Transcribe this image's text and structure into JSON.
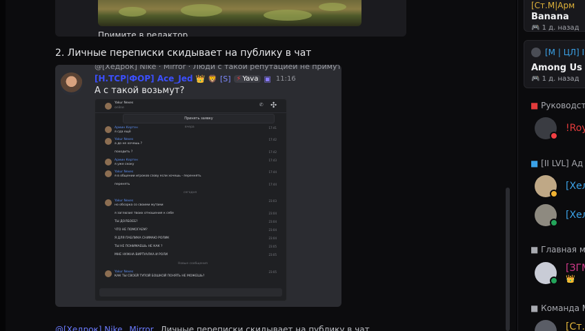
{
  "chat": {
    "top_card_caption": "Примите в редактор",
    "heading": "2. Личные переписки скидывает на публику в чат",
    "embed": {
      "reply_preview": "@[Хедрок] Nike · Mirror · Люди с такой репутацией не примут",
      "author": "[Н.ТСР|ФОР] Ace_Jed",
      "role_label": "Yava",
      "time": "11:16",
      "text": "А с такой возьмут?",
      "screenshot": {
        "header_name": "Yakur Nexes",
        "header_sub": "online",
        "accept_label": "Принять заявку",
        "messages": [
          {
            "name": "Армин Кертен",
            "text": "я сда ещё",
            "time": "17:41"
          },
          {
            "name": "Yakur Nexes",
            "text": "а до не хочешь ?",
            "time": "17:42"
          },
          {
            "name": "",
            "text": "походить ?",
            "time": "17:42"
          },
          {
            "name": "Армин Кертен",
            "text": "я уже скоку",
            "time": "17:43"
          },
          {
            "name": "Yakur Nexes",
            "text": "я в общении игроков сзову если хочешь - переннять",
            "time": "17:44"
          },
          {
            "name": "",
            "text": "перенять",
            "time": "17:44"
          },
          {
            "name": "Yakur Nexes",
            "text": "но обсорка со своими мутами",
            "time": "23:03"
          },
          {
            "name": "",
            "text": "я заглюзил твоих отношения к себе",
            "time": "23:04"
          },
          {
            "name": "",
            "text": "ТЫ ДОЛБОЕБ?",
            "time": "23:04"
          },
          {
            "name": "",
            "text": "ЧТО НЕ ПОМОГАЕМ?",
            "time": "23:04"
          },
          {
            "name": "",
            "text": "Я ДЛЯ ПАБЛИКА СНИМАЮ РОЛИК",
            "time": "23:04"
          },
          {
            "name": "",
            "text": "ТЫ НЕ ПОНИМАЕШЬ НЕ КАК ?",
            "time": "23:05"
          },
          {
            "name": "",
            "text": "МНЕ НУЖНА ВИРТУАЛКА И РОЛИ",
            "time": "23:05"
          },
          {
            "name": "Yakur Nexes",
            "text": "КАК ТЫ СВОЕЙ ТУПОЙ БОШКОЙ ПОНЯТЬ НЕ МОЖЕШЬ?",
            "time": "23:05"
          }
        ],
        "divider_1": "вчера",
        "divider_2": "сегодня",
        "divider_3": "Новые сообщения"
      }
    },
    "bottom_line": {
      "mention": "@[Хедрок] Nike",
      "middle": "Mirror",
      "text": "Личные переписки скидывает на публику в чат"
    }
  },
  "sidebar": {
    "cards": [
      {
        "title": "[Ст.М|Арм",
        "game": "Banana",
        "time": "1 д. назад"
      },
      {
        "title": "[М | ЦЛ] I",
        "game": "Among Us",
        "time": "1 д. назад"
      }
    ],
    "sections": [
      {
        "label": "Руководст",
        "members": [
          {
            "name": "!Roy",
            "color": "#e23b3b",
            "status": "dnd"
          }
        ]
      },
      {
        "label": "[II LVL] Ад",
        "members": [
          {
            "name": "[Хел",
            "color": "#3ba2e8",
            "status": "idle"
          },
          {
            "name": "[Хел",
            "color": "#3ba2e8",
            "status": "online"
          }
        ]
      },
      {
        "label": "Главная м",
        "members": [
          {
            "name": "[ЗГМ",
            "color": "#d63b8d",
            "status": "online"
          }
        ]
      },
      {
        "label": "Команда М",
        "members": [
          {
            "name": "[Ст.М",
            "color": "#e0b33a",
            "status": "online"
          }
        ]
      }
    ]
  },
  "colors": {
    "accent": "#3b4fff",
    "online": "#23a55a",
    "dnd": "#f23f43",
    "idle": "#f0b232"
  }
}
